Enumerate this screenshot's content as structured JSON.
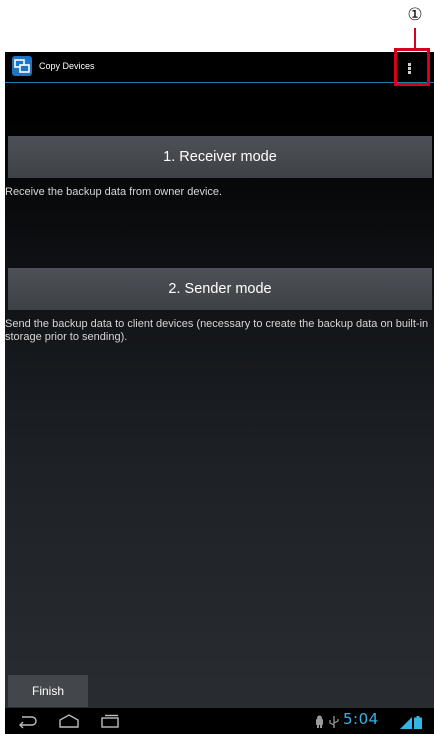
{
  "annotation": {
    "callout_number": "①"
  },
  "actionbar": {
    "title": "Copy Devices"
  },
  "receiver": {
    "button_label": "1. Receiver mode",
    "description": "Receive the backup data from owner device."
  },
  "sender": {
    "button_label": "2. Sender mode",
    "description": "Send the backup data to client devices (necessary to create the backup data on built-in storage prior to sending)."
  },
  "footer": {
    "finish_label": "Finish"
  },
  "statusbar": {
    "time": "5:04"
  },
  "colors": {
    "accent": "#33b5e5",
    "divider": "#1f7fa8",
    "callout": "#d6001c",
    "button_bg": "#464a50"
  },
  "icons": [
    "app-icon",
    "overflow-menu-icon",
    "back-icon",
    "home-icon",
    "recent-apps-icon",
    "android-debug-icon",
    "usb-icon",
    "signal-icon",
    "battery-icon"
  ]
}
